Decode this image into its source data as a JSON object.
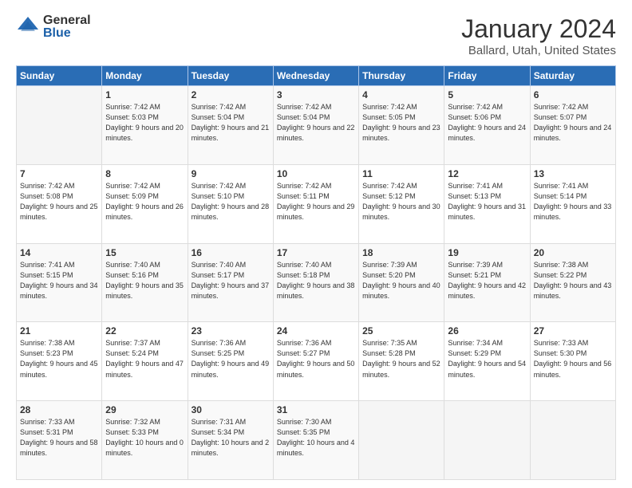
{
  "header": {
    "logo_general": "General",
    "logo_blue": "Blue",
    "month_title": "January 2024",
    "location": "Ballard, Utah, United States"
  },
  "weekdays": [
    "Sunday",
    "Monday",
    "Tuesday",
    "Wednesday",
    "Thursday",
    "Friday",
    "Saturday"
  ],
  "weeks": [
    [
      {
        "day": "",
        "sunrise": "",
        "sunset": "",
        "daylight": ""
      },
      {
        "day": "1",
        "sunrise": "Sunrise: 7:42 AM",
        "sunset": "Sunset: 5:03 PM",
        "daylight": "Daylight: 9 hours and 20 minutes."
      },
      {
        "day": "2",
        "sunrise": "Sunrise: 7:42 AM",
        "sunset": "Sunset: 5:04 PM",
        "daylight": "Daylight: 9 hours and 21 minutes."
      },
      {
        "day": "3",
        "sunrise": "Sunrise: 7:42 AM",
        "sunset": "Sunset: 5:04 PM",
        "daylight": "Daylight: 9 hours and 22 minutes."
      },
      {
        "day": "4",
        "sunrise": "Sunrise: 7:42 AM",
        "sunset": "Sunset: 5:05 PM",
        "daylight": "Daylight: 9 hours and 23 minutes."
      },
      {
        "day": "5",
        "sunrise": "Sunrise: 7:42 AM",
        "sunset": "Sunset: 5:06 PM",
        "daylight": "Daylight: 9 hours and 24 minutes."
      },
      {
        "day": "6",
        "sunrise": "Sunrise: 7:42 AM",
        "sunset": "Sunset: 5:07 PM",
        "daylight": "Daylight: 9 hours and 24 minutes."
      }
    ],
    [
      {
        "day": "7",
        "sunrise": "Sunrise: 7:42 AM",
        "sunset": "Sunset: 5:08 PM",
        "daylight": "Daylight: 9 hours and 25 minutes."
      },
      {
        "day": "8",
        "sunrise": "Sunrise: 7:42 AM",
        "sunset": "Sunset: 5:09 PM",
        "daylight": "Daylight: 9 hours and 26 minutes."
      },
      {
        "day": "9",
        "sunrise": "Sunrise: 7:42 AM",
        "sunset": "Sunset: 5:10 PM",
        "daylight": "Daylight: 9 hours and 28 minutes."
      },
      {
        "day": "10",
        "sunrise": "Sunrise: 7:42 AM",
        "sunset": "Sunset: 5:11 PM",
        "daylight": "Daylight: 9 hours and 29 minutes."
      },
      {
        "day": "11",
        "sunrise": "Sunrise: 7:42 AM",
        "sunset": "Sunset: 5:12 PM",
        "daylight": "Daylight: 9 hours and 30 minutes."
      },
      {
        "day": "12",
        "sunrise": "Sunrise: 7:41 AM",
        "sunset": "Sunset: 5:13 PM",
        "daylight": "Daylight: 9 hours and 31 minutes."
      },
      {
        "day": "13",
        "sunrise": "Sunrise: 7:41 AM",
        "sunset": "Sunset: 5:14 PM",
        "daylight": "Daylight: 9 hours and 33 minutes."
      }
    ],
    [
      {
        "day": "14",
        "sunrise": "Sunrise: 7:41 AM",
        "sunset": "Sunset: 5:15 PM",
        "daylight": "Daylight: 9 hours and 34 minutes."
      },
      {
        "day": "15",
        "sunrise": "Sunrise: 7:40 AM",
        "sunset": "Sunset: 5:16 PM",
        "daylight": "Daylight: 9 hours and 35 minutes."
      },
      {
        "day": "16",
        "sunrise": "Sunrise: 7:40 AM",
        "sunset": "Sunset: 5:17 PM",
        "daylight": "Daylight: 9 hours and 37 minutes."
      },
      {
        "day": "17",
        "sunrise": "Sunrise: 7:40 AM",
        "sunset": "Sunset: 5:18 PM",
        "daylight": "Daylight: 9 hours and 38 minutes."
      },
      {
        "day": "18",
        "sunrise": "Sunrise: 7:39 AM",
        "sunset": "Sunset: 5:20 PM",
        "daylight": "Daylight: 9 hours and 40 minutes."
      },
      {
        "day": "19",
        "sunrise": "Sunrise: 7:39 AM",
        "sunset": "Sunset: 5:21 PM",
        "daylight": "Daylight: 9 hours and 42 minutes."
      },
      {
        "day": "20",
        "sunrise": "Sunrise: 7:38 AM",
        "sunset": "Sunset: 5:22 PM",
        "daylight": "Daylight: 9 hours and 43 minutes."
      }
    ],
    [
      {
        "day": "21",
        "sunrise": "Sunrise: 7:38 AM",
        "sunset": "Sunset: 5:23 PM",
        "daylight": "Daylight: 9 hours and 45 minutes."
      },
      {
        "day": "22",
        "sunrise": "Sunrise: 7:37 AM",
        "sunset": "Sunset: 5:24 PM",
        "daylight": "Daylight: 9 hours and 47 minutes."
      },
      {
        "day": "23",
        "sunrise": "Sunrise: 7:36 AM",
        "sunset": "Sunset: 5:25 PM",
        "daylight": "Daylight: 9 hours and 49 minutes."
      },
      {
        "day": "24",
        "sunrise": "Sunrise: 7:36 AM",
        "sunset": "Sunset: 5:27 PM",
        "daylight": "Daylight: 9 hours and 50 minutes."
      },
      {
        "day": "25",
        "sunrise": "Sunrise: 7:35 AM",
        "sunset": "Sunset: 5:28 PM",
        "daylight": "Daylight: 9 hours and 52 minutes."
      },
      {
        "day": "26",
        "sunrise": "Sunrise: 7:34 AM",
        "sunset": "Sunset: 5:29 PM",
        "daylight": "Daylight: 9 hours and 54 minutes."
      },
      {
        "day": "27",
        "sunrise": "Sunrise: 7:33 AM",
        "sunset": "Sunset: 5:30 PM",
        "daylight": "Daylight: 9 hours and 56 minutes."
      }
    ],
    [
      {
        "day": "28",
        "sunrise": "Sunrise: 7:33 AM",
        "sunset": "Sunset: 5:31 PM",
        "daylight": "Daylight: 9 hours and 58 minutes."
      },
      {
        "day": "29",
        "sunrise": "Sunrise: 7:32 AM",
        "sunset": "Sunset: 5:33 PM",
        "daylight": "Daylight: 10 hours and 0 minutes."
      },
      {
        "day": "30",
        "sunrise": "Sunrise: 7:31 AM",
        "sunset": "Sunset: 5:34 PM",
        "daylight": "Daylight: 10 hours and 2 minutes."
      },
      {
        "day": "31",
        "sunrise": "Sunrise: 7:30 AM",
        "sunset": "Sunset: 5:35 PM",
        "daylight": "Daylight: 10 hours and 4 minutes."
      },
      {
        "day": "",
        "sunrise": "",
        "sunset": "",
        "daylight": ""
      },
      {
        "day": "",
        "sunrise": "",
        "sunset": "",
        "daylight": ""
      },
      {
        "day": "",
        "sunrise": "",
        "sunset": "",
        "daylight": ""
      }
    ]
  ]
}
